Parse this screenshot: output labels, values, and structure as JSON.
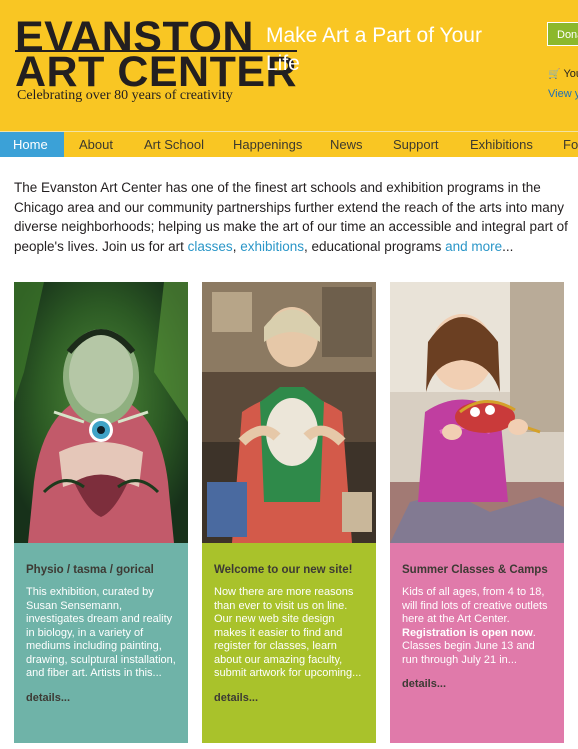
{
  "header": {
    "logo_line1": "EVANSTON",
    "logo_line2": "ART CENTER",
    "logo_tag": "Celebrating over 80 years of creativity",
    "tagline": "Make Art a Part of Your Life",
    "donate_label": "Donate",
    "cart_text": "Your Cart",
    "view_link": "View your cart"
  },
  "nav": {
    "items": [
      {
        "label": "Home"
      },
      {
        "label": "About"
      },
      {
        "label": "Art School"
      },
      {
        "label": "Happenings"
      },
      {
        "label": "News"
      },
      {
        "label": "Support"
      },
      {
        "label": "Exhibitions"
      },
      {
        "label": "For"
      }
    ],
    "active": "Home"
  },
  "intro": {
    "text1": "The Evanston Art Center has one of the finest art schools and exhibition programs in the Chicago area and our community partnerships further extend the reach of the arts into many diverse neighborhoods; helping us make the art of our time an accessible and integral part of people's lives. Join us for art ",
    "link_classes": "classes",
    "sep1": ", ",
    "link_exhibitions": "exhibitions",
    "text2": ", educational programs ",
    "link_more": "and more",
    "text3": "..."
  },
  "cards": [
    {
      "title": "Physio / tasma / gorical",
      "text": "This exhibition, curated by Susan Sensemann, investigates dream and reality in biology, in a variety of mediums including painting, drawing, sculptural installation, and fiber art. Artists in this...",
      "details": "details...",
      "color": "#6fb3a8"
    },
    {
      "title": "Welcome to our new site!",
      "text": "Now there are more reasons than ever to visit us on line. Our new web site design makes it easier to find and register for classes, learn about our amazing faculty, submit artwork for upcoming...",
      "details": "details...",
      "color": "#a9c22b"
    },
    {
      "title": "Summer Classes & Camps",
      "text_a": "Kids of all ages, from 4 to 18, will find lots of creative outlets here at the Art Center. ",
      "text_bold": "Registration is open now",
      "text_b": ". Classes begin June 13 and run through July 21 in...",
      "details": "details...",
      "color": "#e07aaa"
    }
  ],
  "colors": {
    "header_bg": "#f9c623",
    "nav_active": "#3ba1d7",
    "link": "#2a96c8",
    "donate": "#8cb82c"
  }
}
